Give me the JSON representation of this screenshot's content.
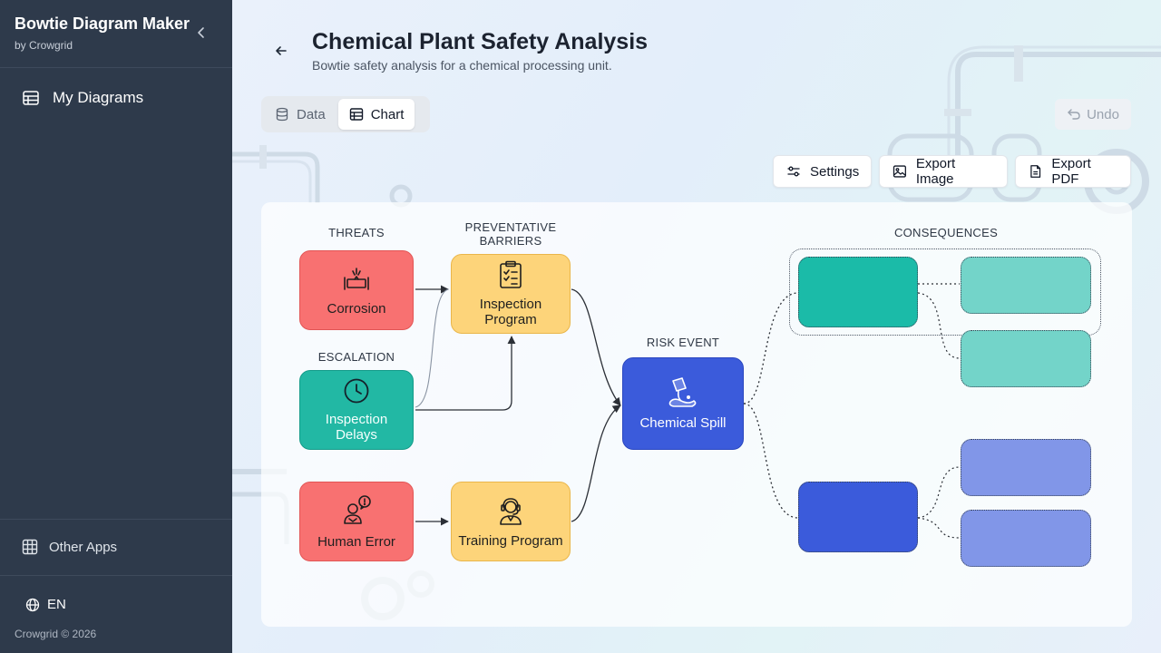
{
  "app": {
    "title": "Bowtie Diagram Maker",
    "subtitle": "by Crowgrid"
  },
  "sidebar": {
    "nav": [
      {
        "label": "My Diagrams",
        "icon": "table-icon"
      }
    ],
    "other_apps": "Other Apps",
    "language": "EN",
    "copyright": "Crowgrid © 2026"
  },
  "page": {
    "title": "Chemical Plant Safety Analysis",
    "subtitle": "Bowtie safety analysis for a chemical processing unit."
  },
  "tabs": [
    {
      "label": "Data",
      "icon": "database-icon",
      "active": false
    },
    {
      "label": "Chart",
      "icon": "table-icon",
      "active": true
    }
  ],
  "toolbar": {
    "undo": "Undo",
    "settings": "Settings",
    "export_image": "Export Image",
    "export_pdf": "Export PDF"
  },
  "diagram": {
    "headers": {
      "threats": "THREATS",
      "barriers": "PREVENTATIVE BARRIERS",
      "escalation": "ESCALATION",
      "risk_event": "RISK EVENT",
      "consequences": "CONSEQUENCES"
    },
    "threats": [
      {
        "label": "Corrosion",
        "icon": "corroded-pipe-icon"
      },
      {
        "label": "Human Error",
        "icon": "worker-alert-icon"
      }
    ],
    "escalation": {
      "label": "Inspection Delays",
      "icon": "clock-icon"
    },
    "barriers": [
      {
        "label": "Inspection Program",
        "icon": "clipboard-checklist-icon"
      },
      {
        "label": "Training Program",
        "icon": "headset-trainer-icon"
      }
    ],
    "risk_event": {
      "label": "Chemical Spill",
      "icon": "spill-icon"
    },
    "colors": {
      "threat": "#f87171",
      "barrier": "#fdd47a",
      "escalation": "#22b8a4",
      "risk_event": "#3b5bdb"
    }
  }
}
